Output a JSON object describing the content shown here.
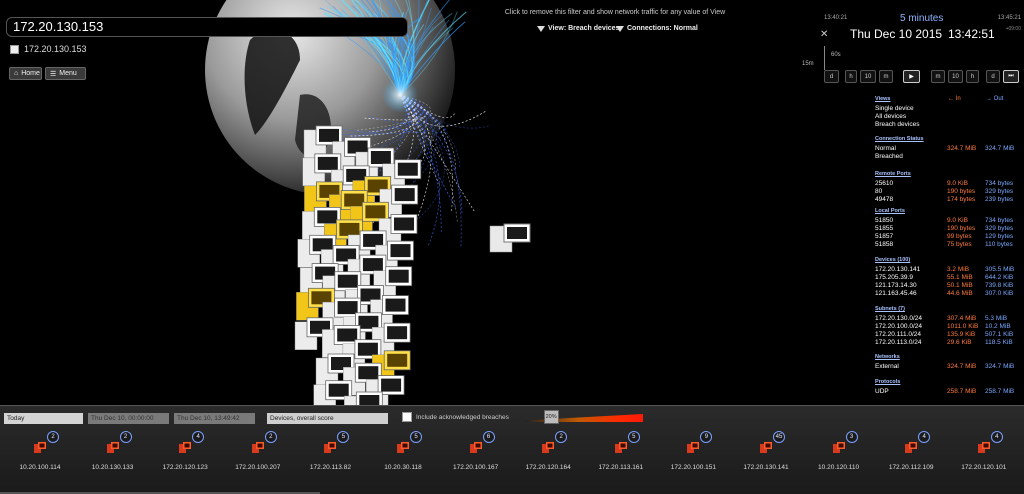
{
  "search": {
    "value": "172.20.130.153"
  },
  "selected_device": {
    "label": "172.20.130.153"
  },
  "toolbar": {
    "home_label": "Home",
    "menu_label": "Menu"
  },
  "filters": {
    "hint": "Click to remove this filter and show network traffic for any value of View",
    "view": "View: Breach devices",
    "connections": "Connections: Normal"
  },
  "time": {
    "start": "13:40:21",
    "end": "13:45:21",
    "window": "5 minutes",
    "tz": "+09:00",
    "date": "Thu Dec 10 2015",
    "clock": "13:42:51",
    "tick_60s": "60s",
    "tick_15m": "15m",
    "controls": [
      "d",
      "h",
      "10",
      "m",
      "▶",
      "m",
      "10",
      "h",
      "d",
      "⏭"
    ]
  },
  "info": {
    "col_in": "In",
    "col_out": "Out",
    "sections": [
      {
        "title": "Views",
        "rows": [
          [
            "Single device",
            "",
            ""
          ],
          [
            "All devices",
            "",
            ""
          ],
          [
            "Breach devices",
            "",
            ""
          ]
        ]
      },
      {
        "title": "Connection Status",
        "rows": [
          [
            "Normal",
            "324.7 MiB",
            "324.7 MiB"
          ],
          [
            "Breached",
            "",
            ""
          ]
        ]
      },
      {
        "title": "Remote Ports",
        "rows": [
          [
            "25610",
            "9.0 KiB",
            "734 bytes"
          ],
          [
            "80",
            "190 bytes",
            "329 bytes"
          ],
          [
            "49478",
            "174 bytes",
            "239 bytes"
          ]
        ]
      },
      {
        "title": "Local Ports",
        "rows": [
          [
            "51850",
            "9.0 KiB",
            "734 bytes"
          ],
          [
            "51855",
            "190 bytes",
            "329 bytes"
          ],
          [
            "51857",
            "99 bytes",
            "129 bytes"
          ],
          [
            "51858",
            "75 bytes",
            "110 bytes"
          ]
        ]
      },
      {
        "title": "Devices (100)",
        "rows": [
          [
            "172.20.130.141",
            "3.2 MiB",
            "305.5 MiB"
          ],
          [
            "175.205.39.9",
            "55.1 MiB",
            "644.2 KiB"
          ],
          [
            "121.173.14.30",
            "50.1 MiB",
            "739.8 KiB"
          ],
          [
            "121.163.45.46",
            "44.6 MiB",
            "307.0 KiB"
          ]
        ]
      },
      {
        "title": "Subnets (7)",
        "rows": [
          [
            "172.20.130.0/24",
            "307.4 MiB",
            "5.3 MiB"
          ],
          [
            "172.20.100.0/24",
            "1011.0 KiB",
            "10.2 MiB"
          ],
          [
            "172.20.111.0/24",
            "135.9 KiB",
            "507.1 KiB"
          ],
          [
            "172.20.113.0/24",
            "29.6 KiB",
            "118.5 KiB"
          ]
        ]
      },
      {
        "title": "Networks",
        "rows": [
          [
            "External",
            "324.7 MiB",
            "324.7 MiB"
          ]
        ]
      },
      {
        "title": "Protocols",
        "rows": [
          [
            "UDP",
            "258.7 MiB",
            "258.7 MiB"
          ]
        ]
      }
    ]
  },
  "bottom": {
    "today": "Today",
    "from": "Thu Dec 10, 00:00:00",
    "to": "Thu Dec 10, 13:49:42",
    "sort": "Devices, overall score",
    "ack_label": "Include acknowledged breaches",
    "slider_value": "20%",
    "slider_fraction": 0.2,
    "devices": [
      {
        "ip": "10.20.100.114",
        "count": "2"
      },
      {
        "ip": "10.20.130.133",
        "count": "2"
      },
      {
        "ip": "172.20.120.123",
        "count": "4"
      },
      {
        "ip": "172.20.100.207",
        "count": "2"
      },
      {
        "ip": "172.20.113.82",
        "count": "5"
      },
      {
        "ip": "10.20.30.118",
        "count": "5"
      },
      {
        "ip": "172.20.100.167",
        "count": "6"
      },
      {
        "ip": "172.20.120.164",
        "count": "2"
      },
      {
        "ip": "172.20.113.161",
        "count": "5"
      },
      {
        "ip": "172.20.100.151",
        "count": "9"
      },
      {
        "ip": "172.20.130.141",
        "count": "45"
      },
      {
        "ip": "10.20.120.110",
        "count": "3"
      },
      {
        "ip": "172.20.112.109",
        "count": "4"
      },
      {
        "ip": "172.20.120.101",
        "count": "4"
      }
    ]
  }
}
